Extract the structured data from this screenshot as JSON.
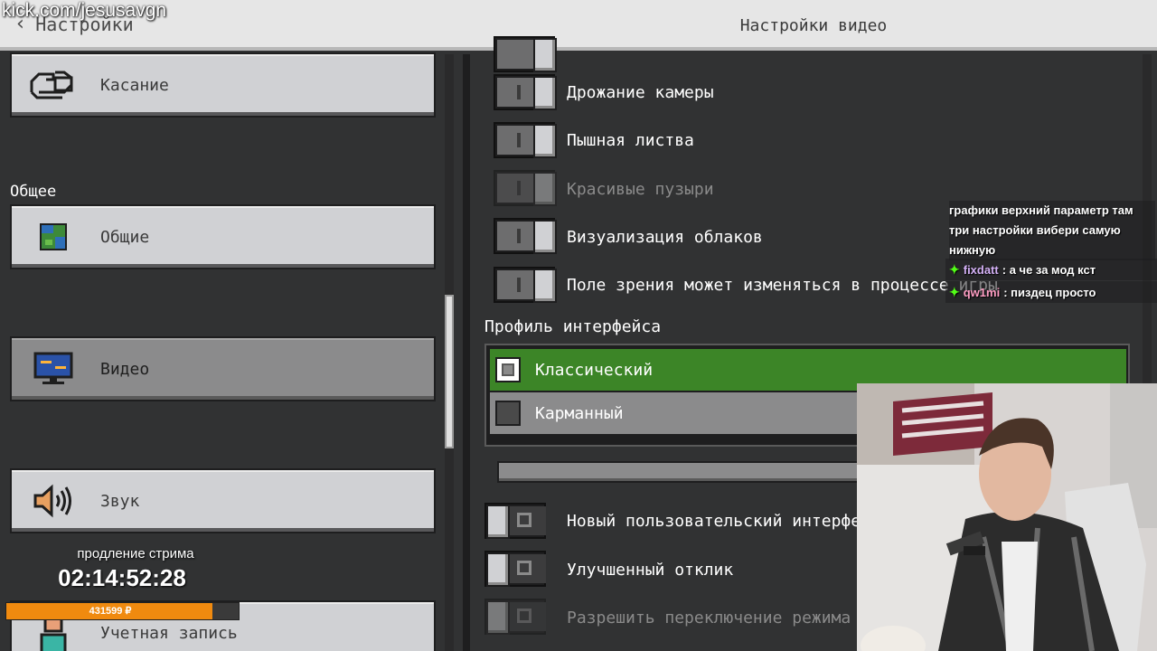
{
  "overlay": {
    "kick_url": "kick.com/jesusavgn"
  },
  "header": {
    "back_label": "Настройки",
    "title": "Настройки видео"
  },
  "sidebar": {
    "section_general": "Общее",
    "items": [
      {
        "label": "Касание",
        "icon": "touch-icon"
      },
      {
        "label": "Общие",
        "icon": "globe-icon"
      },
      {
        "label": "Видео",
        "icon": "monitor-icon"
      },
      {
        "label": "Звук",
        "icon": "speaker-icon"
      },
      {
        "label": "Учетная запись",
        "icon": "account-icon"
      }
    ]
  },
  "video_options": [
    {
      "label": "Дрожание камеры",
      "state": "on",
      "enabled": true
    },
    {
      "label": "Пышная листва",
      "state": "on",
      "enabled": true
    },
    {
      "label": "Красивые пузыри",
      "state": "on",
      "enabled": false
    },
    {
      "label": "Визуализация облаков",
      "state": "on",
      "enabled": true
    },
    {
      "label": "Поле зрения может изменяться в процессе игры",
      "state": "on",
      "enabled": true
    }
  ],
  "profile": {
    "title": "Профиль интерфейса",
    "options": [
      {
        "label": "Классический",
        "selected": true
      },
      {
        "label": "Карманный",
        "selected": false
      }
    ]
  },
  "lower_options": [
    {
      "label": "Новый пользовательский интерфейс",
      "state": "off",
      "enabled": true
    },
    {
      "label": "Улучшенный отклик",
      "state": "off",
      "enabled": true
    },
    {
      "label": "Разрешить переключение режима",
      "state": "off",
      "enabled": false
    }
  ],
  "chat": {
    "continued": "графики верхний параметр там три настройки вибери самую нижную",
    "messages": [
      {
        "user": "fixdatt",
        "user_color": "#d3b0f5",
        "text": "а че за мод кст"
      },
      {
        "user": "qw1mi",
        "user_color": "#ff9ec4",
        "text": "пиздец просто"
      }
    ]
  },
  "stream": {
    "label": "продление стрима",
    "timer": "02:14:52:28",
    "amount": "431599 ₽",
    "progress": 0.88
  },
  "colors": {
    "accent_green": "#3c8527",
    "kick_green": "#53fc18",
    "progress_orange": "#f08a0f"
  }
}
